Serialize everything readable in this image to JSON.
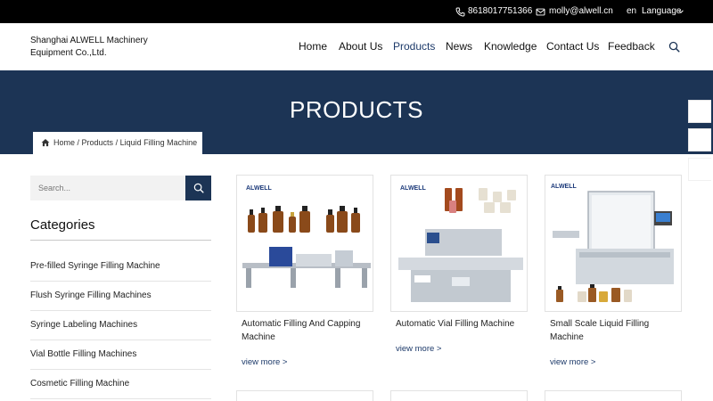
{
  "topbar": {
    "phone": "8618017751366",
    "email": "molly@alwell.cn",
    "lang_code": "en",
    "lang_label": "Language",
    "icons": [
      "phone-icon",
      "mail-icon",
      "chevron-down-icon"
    ]
  },
  "header": {
    "company": "Shanghai ALWELL Machinery Equipment Co.,Ltd.",
    "nav": [
      "Home",
      "About Us",
      "Products",
      "News",
      "Knowledge",
      "Contact Us",
      "Feedback"
    ],
    "active_nav": "Products"
  },
  "banner": {
    "title": "PRODUCTS",
    "breadcrumb": {
      "home": "Home",
      "sep": " / ",
      "products": "Products",
      "current": "Liquid Filling Machine"
    }
  },
  "sidebar": {
    "search_placeholder": "Search...",
    "categories_title": "Categories",
    "categories": [
      "Pre-filled Syringe Filling Machine",
      "Flush Syringe Filling Machines",
      "Syringe Labeling Machines",
      "Vial Bottle Filling Machines",
      "Cosmetic Filling Machine"
    ]
  },
  "products": [
    {
      "title": "Automatic Filling And Capping Machine",
      "more": "view more >",
      "logo": "ALWELL"
    },
    {
      "title": "Automatic Vial Filling Machine",
      "more": "view more >",
      "logo": "ALWELL"
    },
    {
      "title": "Small Scale Liquid Filling Machine",
      "more": "view more >",
      "logo": "ALWELL"
    }
  ],
  "colors": {
    "topbar": "#000000",
    "banner": "#1c3455",
    "accent": "#1d3a6a"
  }
}
